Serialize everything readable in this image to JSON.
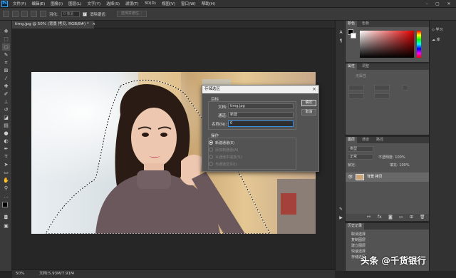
{
  "menubar": {
    "logo": "Ps",
    "items": [
      "文件(F)",
      "编辑(E)",
      "图像(I)",
      "图层(L)",
      "文字(Y)",
      "选择(S)",
      "滤镜(T)",
      "3D(D)",
      "视图(V)",
      "窗口(W)",
      "帮助(H)"
    ],
    "minimize": "–",
    "maximize": "▢",
    "close": "✕"
  },
  "options": {
    "feather_label": "羽化:",
    "feather_value": "0 像素",
    "antialias_label": "消除锯齿",
    "antialias_checked": "✓",
    "select_mask_button": "选择并遮住..."
  },
  "document": {
    "tab_title": "timg.jpg @ 50% (背景 拷贝, RGB/8#) *",
    "tab_close": "×"
  },
  "status": {
    "zoom": "50%",
    "doc_info": "文档:5.93M/7.91M",
    "arrow": "›"
  },
  "dialog": {
    "title": "存储选区",
    "close": "×",
    "target_group": "目标",
    "document_label": "文档:",
    "document_value": "timg.jpg",
    "channel_label": "通道:",
    "channel_value": "新建",
    "name_label": "名称(N):",
    "name_value": "0",
    "ok_button": "确定",
    "cancel_button": "取消",
    "operation_group": "操作",
    "op_new": "新建通道(E)",
    "op_add": "添加到通道(A)",
    "op_subtract": "从通道中减去(S)",
    "op_intersect": "与通道交叉(I)"
  },
  "panels": {
    "color_tabs": [
      "颜色",
      "色板"
    ],
    "properties_tabs": [
      "属性",
      "调整"
    ],
    "properties_empty": "无属性",
    "layers_tabs": [
      "图层",
      "通道",
      "路径"
    ],
    "layer_kind": "类型",
    "layer_mode": "正常",
    "layer_opacity": "不透明度: 100%",
    "layer_lock": "锁定:",
    "layer_fill": "填充: 100%",
    "layer_name": "背景 拷贝",
    "history_tab": "历史记录",
    "history_items": [
      "取消选择",
      "复制图层",
      "建立图层",
      "快速选择",
      "存储选区"
    ]
  },
  "right_dock": {
    "learn": "学习",
    "libraries": "库"
  },
  "watermark": "头条 @千货银行",
  "colors": {
    "accent": "#31a8ff",
    "panel": "#535353",
    "ui_dark": "#323232"
  }
}
